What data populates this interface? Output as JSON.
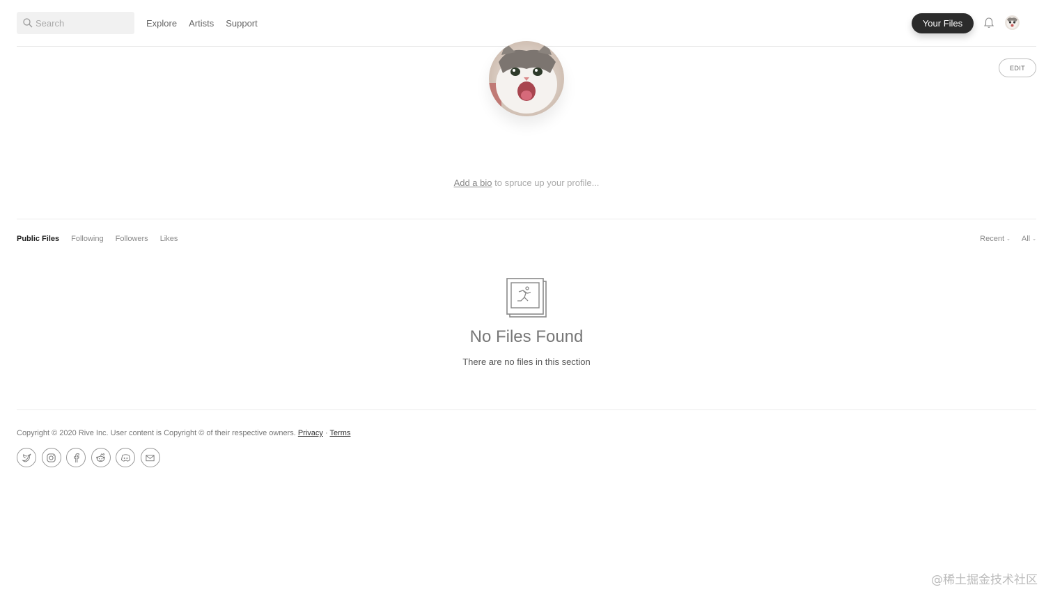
{
  "header": {
    "search_placeholder": "Search",
    "nav": [
      "Explore",
      "Artists",
      "Support"
    ],
    "your_files_label": "Your Files"
  },
  "profile": {
    "edit_label": "EDIT",
    "bio_link": "Add a bio",
    "bio_rest": " to spruce up your profile..."
  },
  "tabs": {
    "items": [
      "Public Files",
      "Following",
      "Followers",
      "Likes"
    ],
    "active": "Public Files",
    "filters": [
      "Recent",
      "All"
    ]
  },
  "empty": {
    "title": "No Files Found",
    "subtitle": "There are no files in this section"
  },
  "footer": {
    "copyright": "Copyright © 2020 Rive Inc. User content is Copyright © of their respective owners.",
    "privacy": "Privacy",
    "separator": " · ",
    "terms": "Terms",
    "social_icons": [
      "twitter-icon",
      "instagram-icon",
      "facebook-icon",
      "reddit-icon",
      "discord-icon",
      "mail-icon"
    ]
  },
  "watermark": "@稀土掘金技术社区",
  "colors": {
    "primary_button": "#2b2b2b",
    "background": "#ffffff",
    "divider": "#ececec"
  }
}
